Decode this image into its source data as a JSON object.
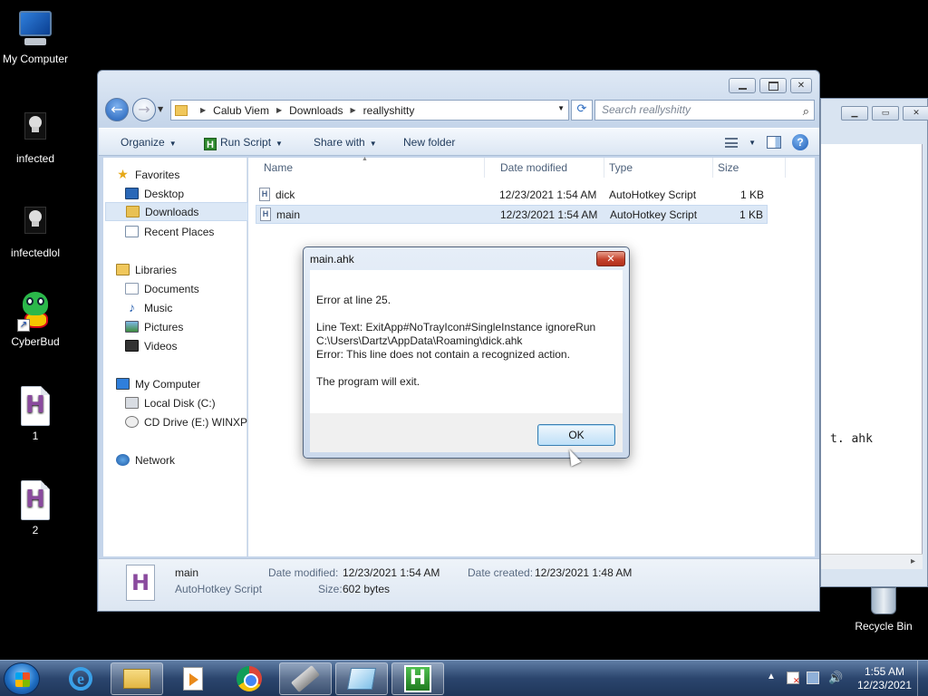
{
  "desktop": {
    "icons": [
      {
        "label": "My Computer",
        "icon": "computer-icon"
      },
      {
        "label": "infected",
        "icon": "skull-icon"
      },
      {
        "label": "infectedlol",
        "icon": "skull-icon"
      },
      {
        "label": "CyberBud",
        "icon": "cyberbud-icon"
      },
      {
        "label": "1",
        "icon": "ahk-file-icon"
      },
      {
        "label": "2",
        "icon": "ahk-file-icon"
      }
    ],
    "recycle_bin": "Recycle Bin"
  },
  "background_window": {
    "visible_text": "t. ahk"
  },
  "explorer": {
    "breadcrumb": [
      "Calub Viem",
      "Downloads",
      "reallyshitty"
    ],
    "search_placeholder": "Search reallyshitty",
    "toolbar": {
      "organize": "Organize",
      "run_script": "Run Script",
      "share_with": "Share with",
      "new_folder": "New folder"
    },
    "nav": {
      "favorites": "Favorites",
      "desktop": "Desktop",
      "downloads": "Downloads",
      "recent_places": "Recent Places",
      "libraries": "Libraries",
      "documents": "Documents",
      "music": "Music",
      "pictures": "Pictures",
      "videos": "Videos",
      "my_computer": "My Computer",
      "local_disk": "Local Disk (C:)",
      "cd_drive": "CD Drive (E:) WINXP",
      "network": "Network"
    },
    "columns": {
      "name": "Name",
      "date_modified": "Date modified",
      "type": "Type",
      "size": "Size"
    },
    "files": [
      {
        "name": "dick",
        "date": "12/23/2021 1:54 AM",
        "type": "AutoHotkey Script",
        "size": "1 KB"
      },
      {
        "name": "main",
        "date": "12/23/2021 1:54 AM",
        "type": "AutoHotkey Script",
        "size": "1 KB"
      }
    ],
    "details": {
      "name": "main",
      "type": "AutoHotkey Script",
      "date_modified_label": "Date modified:",
      "date_modified": "12/23/2021 1:54 AM",
      "date_created_label": "Date created:",
      "date_created": "12/23/2021 1:48 AM",
      "size_label": "Size:",
      "size": "602 bytes"
    }
  },
  "dialog": {
    "title": "main.ahk",
    "line1": "Error at line 25.",
    "line2": "Line Text: ExitApp#NoTrayIcon#SingleInstance ignoreRun",
    "line3": "C:\\Users\\Dartz\\AppData\\Roaming\\dick.ahk",
    "line4": "Error: This line does not contain a recognized action.",
    "line5": "The program will exit.",
    "ok": "OK"
  },
  "taskbar": {
    "apps": [
      "internet-explorer-icon",
      "windows-explorer-icon",
      "media-player-icon",
      "chrome-icon",
      "usb-tool-icon",
      "notepad-icon",
      "autohotkey-icon"
    ],
    "time": "1:55 AM",
    "date": "12/23/2021"
  }
}
